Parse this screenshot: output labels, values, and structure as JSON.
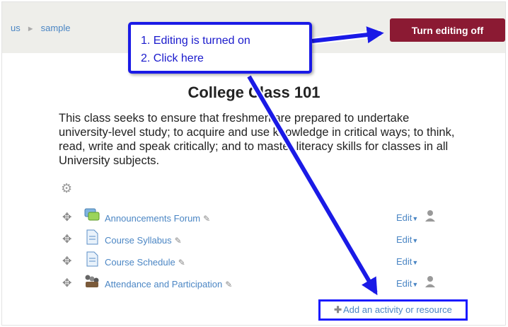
{
  "breadcrumb": {
    "items": [
      "us",
      "sample"
    ]
  },
  "header": {
    "edit_button_label": "Turn editing off"
  },
  "course": {
    "title": "College Class 101",
    "summary": "This class seeks to ensure that freshmen are prepared to undertake university-level study; to acquire and use knowledge in critical ways; to think, read, write and speak critically; and to master literacy skills for classes in all University subjects."
  },
  "activities": [
    {
      "name": "Announcements Forum",
      "icon": "forum-icon",
      "edit_label": "Edit",
      "has_person_icon": true
    },
    {
      "name": "Course Syllabus",
      "icon": "file-icon",
      "edit_label": "Edit",
      "has_person_icon": false
    },
    {
      "name": "Course Schedule",
      "icon": "file-icon",
      "edit_label": "Edit",
      "has_person_icon": false
    },
    {
      "name": "Attendance and Participation",
      "icon": "attendance-icon",
      "edit_label": "Edit",
      "has_person_icon": true
    }
  ],
  "add_activity": {
    "label": "Add an activity or resource"
  },
  "callout": {
    "line1": "1. Editing is turned on",
    "line2": "2. Click here"
  },
  "colors": {
    "accent_button": "#8b1a33",
    "link": "#4b86c4",
    "annotation": "#1a1ae6"
  }
}
